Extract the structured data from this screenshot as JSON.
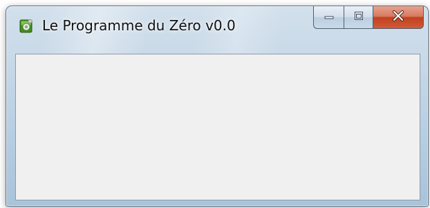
{
  "window": {
    "title": "Le Programme du Zéro v0.0",
    "icon": "app-icon",
    "controls": {
      "minimize": "minimize-icon",
      "maximize": "maximize-icon",
      "close": "close-icon"
    }
  },
  "colors": {
    "client_background": "#f0f0f0",
    "close_button": "#c8442a",
    "frame": "#c7d8e7"
  }
}
